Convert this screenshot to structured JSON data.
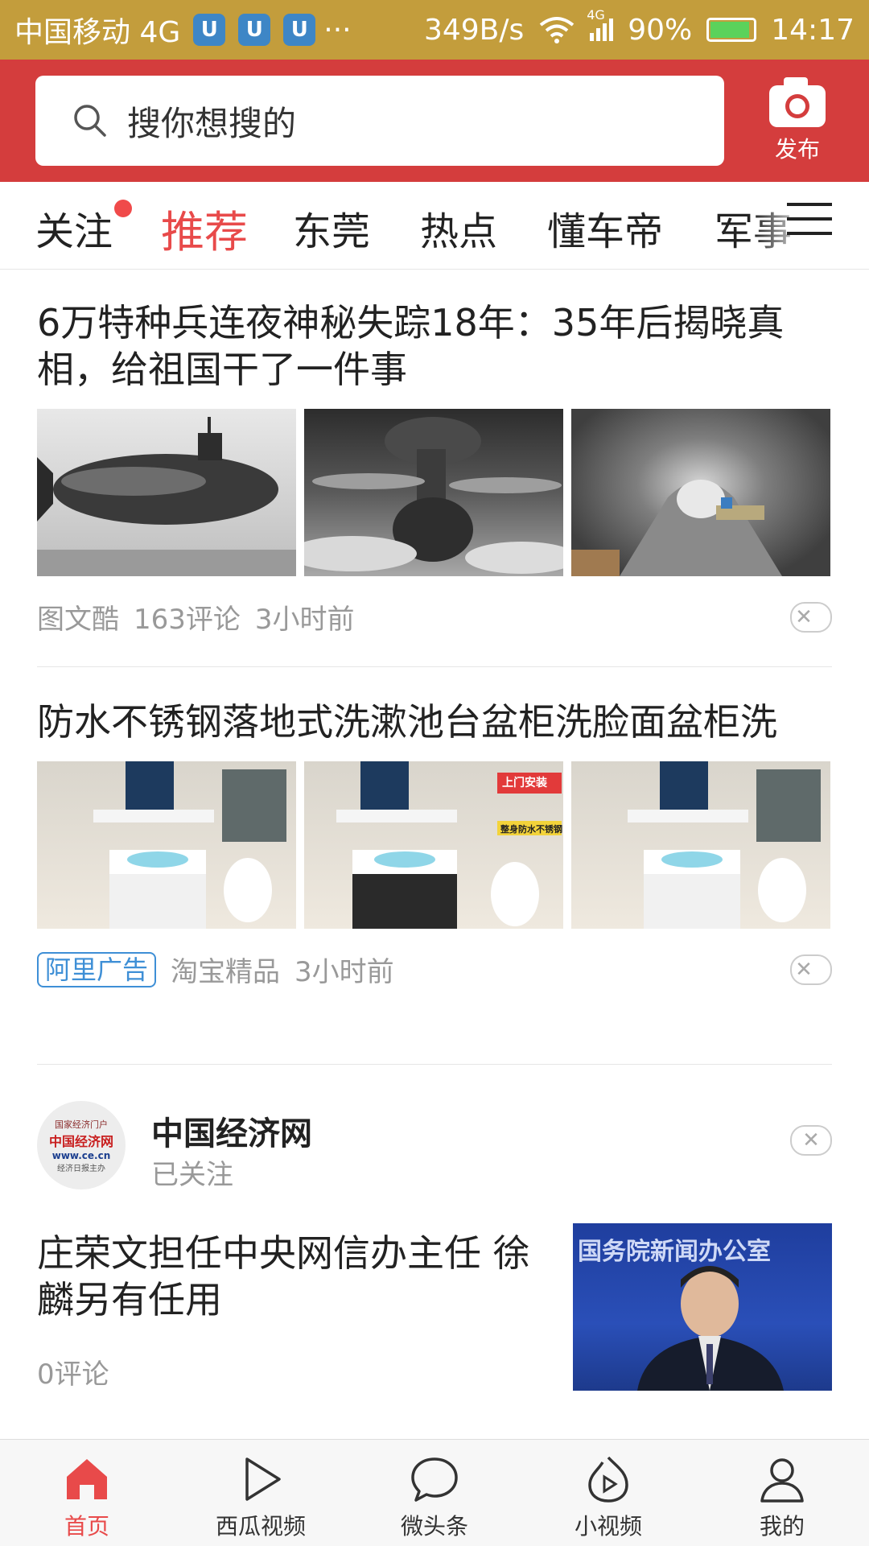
{
  "status_bar": {
    "carrier": "中国移动 4G",
    "app_icons": [
      "U",
      "U",
      "U"
    ],
    "more": "···",
    "net_speed": "349B/s",
    "signal_label": "4G",
    "battery": "90%",
    "battery_level": 0.9,
    "time": "14:17"
  },
  "header": {
    "search_placeholder": "搜你想搜的",
    "publish_label": "发布"
  },
  "tabs": [
    "关注",
    "推荐",
    "东莞",
    "热点",
    "懂车帝",
    "军事"
  ],
  "articles": [
    {
      "title": "6万特种兵连夜神秘失踪18年：35年后揭晓真相，给祖国干了一件事",
      "source": "图文酷",
      "comments": "163评论",
      "time": "3小时前"
    },
    {
      "title": "防水不锈钢落地式洗漱池台盆柜洗脸面盆柜洗",
      "ad_label": "阿里广告",
      "source": "淘宝精品",
      "time": "3小时前",
      "overlay_text_1": "上门安装",
      "overlay_text_2": "整身防水不锈钢"
    },
    {
      "account_name": "中国经济网",
      "account_status": "已关注",
      "title": "庄荣文担任中央网信办主任 徐麟另有任用",
      "comments": "0评论",
      "logo_text_top": "国家经济门户",
      "logo_text_main": "中国经济网",
      "logo_text_url": "www.ce.cn",
      "logo_text_bottom": "经济日报主办",
      "photo_text": "国务院新闻办公室"
    }
  ],
  "bottom_nav": [
    "首页",
    "西瓜视频",
    "微头条",
    "小视频",
    "我的"
  ],
  "colors": {
    "accent": "#e84a4a",
    "header_red": "#d43d3d",
    "status_gold": "#c39d3c",
    "ad_blue": "#3e8fd6"
  }
}
